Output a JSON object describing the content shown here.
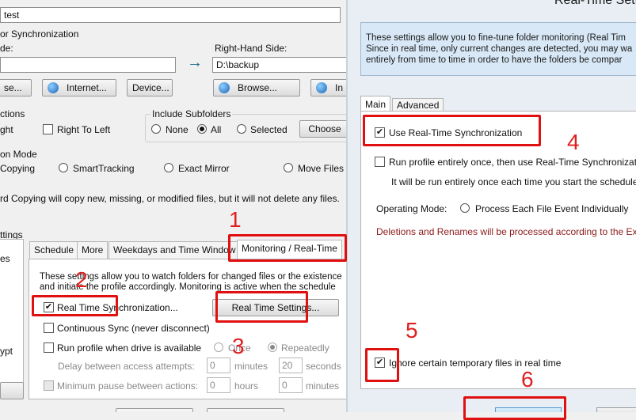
{
  "left_window": {
    "profile_name": "test",
    "folders_group_label": "or Synchronization",
    "left_side_label": "de:",
    "right_side_label": "Right-Hand Side:",
    "left_path": "",
    "right_path": "D:\\backup",
    "arrow": "→",
    "left_browse": "se...",
    "internet_button": "Internet...",
    "device_button": "Device...",
    "right_browse": "Browse...",
    "right_internet_partial": "In",
    "actions_label": "ctions",
    "right_option": "ght",
    "right_to_left": "Right To Left",
    "include_subfolders_label": "Include Subfolders",
    "subfolder_none": "None",
    "subfolder_all": "All",
    "subfolder_selected": "Selected",
    "choose_button": "Choose",
    "mode_label": "on Mode",
    "mode_copying": "Copying",
    "mode_smarttracking": "SmartTracking",
    "mode_exact_mirror": "Exact Mirror",
    "mode_move_files": "Move Files",
    "mode_description": "rd Copying will copy new, missing, or modified files, but it will not delete any files.",
    "settings_label": "ttings",
    "list_item_1": "es",
    "list_item_2": "ypt",
    "tabs": [
      "Schedule",
      "More",
      "Weekdays and Time Window",
      "Monitoring / Real-Time"
    ],
    "monitor_description_1": "These settings allow you to watch folders for changed files or the existence",
    "monitor_description_2": "and initiate the profile accordingly. Monitoring is active when the schedule",
    "rt_sync_label": "Real Time Synchronization...",
    "rt_settings_button": "Real Time Settings...",
    "continuous_sync": "Continuous Sync (never disconnect)",
    "run_when_drive": "Run profile when drive is available",
    "once_label": "Once",
    "repeatedly_label": "Repeatedly",
    "delay_label": "Delay between access attempts:",
    "delay_value": "0",
    "delay_unit": "minutes",
    "delay_value_2": "20",
    "delay_unit_2": "seconds",
    "min_pause_label": "Minimum pause between actions:",
    "pause_hours_value": "0",
    "pause_hours_unit": "hours",
    "pause_minutes_value": "0",
    "pause_minutes_unit": "minutes"
  },
  "right_dialog": {
    "title": "Real-Time Setti",
    "info_line_1": "These settings allow you to fine-tune folder monitoring (Real Tim",
    "info_line_2": "Since in real time, only current changes are detected, you may wa",
    "info_line_3": "entirely from time to time in order to have the folders be compar",
    "tab_main": "Main",
    "tab_advanced": "Advanced",
    "use_rt_sync": "Use Real-Time Synchronization",
    "run_once_label": "Run profile entirely once, then use Real-Time Synchronizati",
    "run_once_note": "It will be run entirely once each time you start the schedule",
    "operating_mode_label": "Operating Mode:",
    "operating_mode_option": "Process Each File Event Individually",
    "deletions_note": "Deletions and Renames will be processed according to the Exac",
    "ignore_temp": "Ignore certain temporary files in real time"
  },
  "annotations": {
    "step_1": "1",
    "step_2": "2",
    "step_3": "3",
    "step_4": "4",
    "step_5": "5",
    "step_6": "6"
  },
  "colors": {
    "annotation_red": "#e01010",
    "info_box_bg": "#d8e8f6",
    "note_maroon": "#8b1a1a",
    "arrow_teal": "#1b6f8a"
  }
}
